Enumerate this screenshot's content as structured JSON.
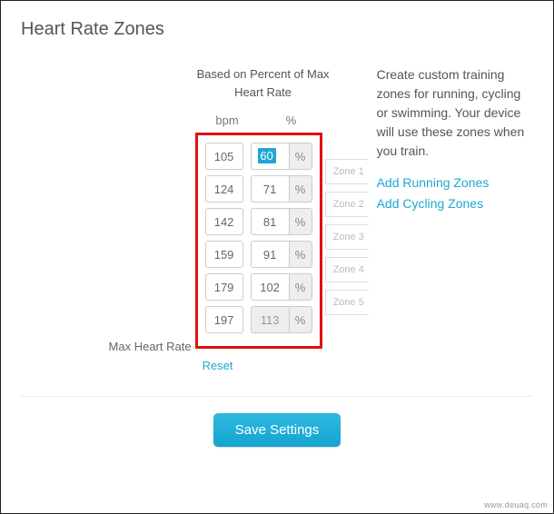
{
  "title": "Heart Rate Zones",
  "basis_label": "Based on Percent of Max Heart Rate",
  "headers": {
    "bpm": "bpm",
    "pct": "%"
  },
  "rows": [
    {
      "bpm": "105",
      "pct": "60",
      "zone": "Zone 1",
      "selected": true
    },
    {
      "bpm": "124",
      "pct": "71",
      "zone": "Zone 2"
    },
    {
      "bpm": "142",
      "pct": "81",
      "zone": "Zone 3"
    },
    {
      "bpm": "159",
      "pct": "91",
      "zone": "Zone 4"
    },
    {
      "bpm": "179",
      "pct": "102",
      "zone": "Zone 5"
    },
    {
      "bpm": "197",
      "pct": "113",
      "readonly": true
    }
  ],
  "pct_symbol": "%",
  "max_hr_label": "Max Heart Rate",
  "reset_label": "Reset",
  "description": "Create custom training zones for running, cycling or swimming. Your device will use these zones when you train.",
  "link_running": "Add Running Zones",
  "link_cycling": "Add Cycling Zones",
  "save_label": "Save Settings",
  "watermark": "www.deuaq.com"
}
